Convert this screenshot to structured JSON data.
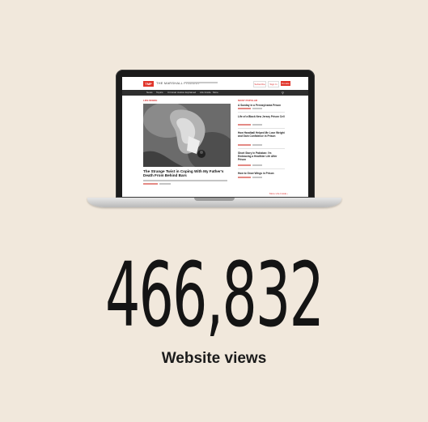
{
  "stat": {
    "value": "466,832",
    "label": "Website views"
  },
  "website": {
    "logo": "TMP",
    "site_name": "THE MARSHALL PROJECT",
    "buttons": {
      "subscribe": "Subscribe",
      "sign_in": "Sign In",
      "donate": "Donate"
    },
    "nav": [
      "News",
      "Topics",
      "Criminal Justice Explained",
      "Life Inside",
      "More"
    ],
    "section_label": "LIFE INSIDE",
    "feature_headline": "The Strange Twist in Coping With My Father's Death From Behind Bars",
    "sidebar_label": "MOST POPULAR",
    "stories": [
      "A Sunday in a Pennsylvania Prison",
      "Life of a Black New Jersey Prison Cell",
      "How Handball Helped Me Lose Weight and Gain Confidence in Prison",
      "Short Story in Pakistan: I'm Embracing a Healthier Life After Prison",
      "How to Grow Wings in Prison"
    ],
    "more_link": "More Life Inside ›"
  },
  "colors": {
    "background": "#f1e8dc",
    "accent": "#e0352b",
    "text": "#141414"
  }
}
